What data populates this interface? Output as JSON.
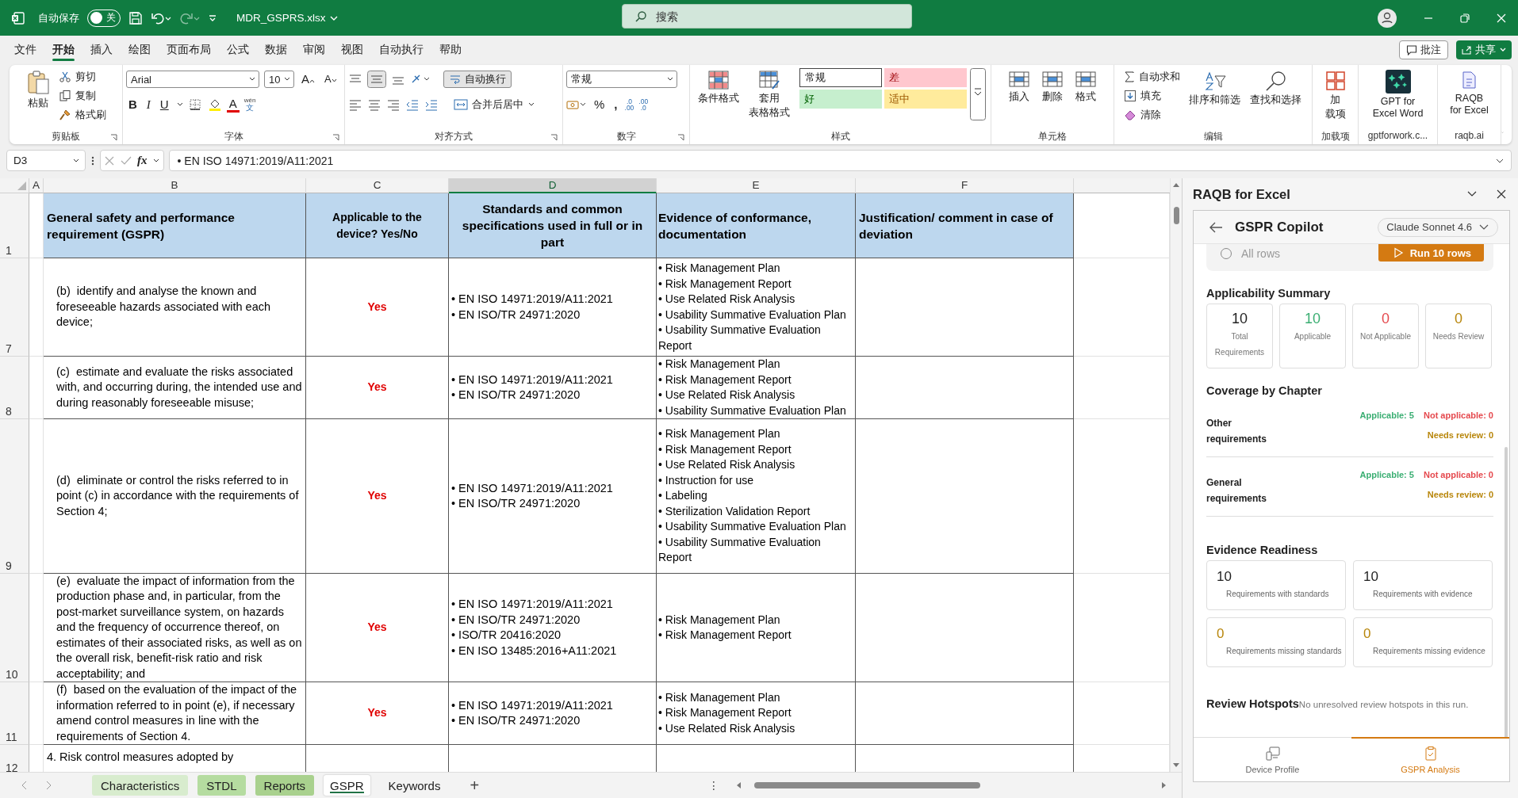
{
  "title_bar": {
    "autosave_label": "自动保存",
    "autosave_toggle": {
      "label": "关",
      "on": false
    },
    "filename": "MDR_GSPRS.xlsx",
    "search_placeholder": "搜索"
  },
  "menu_tabs": [
    {
      "label": "文件",
      "selected": false
    },
    {
      "label": "开始",
      "selected": true
    },
    {
      "label": "插入",
      "selected": false
    },
    {
      "label": "绘图",
      "selected": false
    },
    {
      "label": "页面布局",
      "selected": false
    },
    {
      "label": "公式",
      "selected": false
    },
    {
      "label": "数据",
      "selected": false
    },
    {
      "label": "审阅",
      "selected": false
    },
    {
      "label": "视图",
      "selected": false
    },
    {
      "label": "自动执行",
      "selected": false
    },
    {
      "label": "帮助",
      "selected": false
    }
  ],
  "comment_button": "批注",
  "share_button": "共享",
  "ribbon": {
    "clipboard": {
      "paste": "粘贴",
      "cut": "剪切",
      "copy": "复制",
      "format_painter": "格式刷",
      "label": "剪贴板"
    },
    "font": {
      "font_name": "Arial",
      "font_size": "10",
      "grow": "A",
      "shrink": "A",
      "bold": "B",
      "italic": "I",
      "underline": "U",
      "font_color": "A",
      "phonetic_top": "wén",
      "phonetic_bottom": "文",
      "label": "字体"
    },
    "alignment": {
      "wrap_text": {
        "label": "自动换行",
        "on": true
      },
      "merge": "合并后居中",
      "label": "对齐方式"
    },
    "number": {
      "format": "常规",
      "percent": "%",
      "comma": ",",
      "decimals": [
        {
          "top": ".0",
          "bottom": ".00"
        },
        {
          "top": ".00",
          "bottom": ".0"
        }
      ],
      "label": "数字"
    },
    "styles": {
      "conditional": "条件格式",
      "table_format": [
        "套用",
        "表格格式"
      ],
      "cell_styles": [
        {
          "label": "常规",
          "kind": "normal"
        },
        {
          "label": "差",
          "kind": "bad"
        },
        {
          "label": "好",
          "kind": "good"
        },
        {
          "label": "适中",
          "kind": "neutral"
        }
      ],
      "label": "样式"
    },
    "cells": {
      "buttons": [
        "插入",
        "删除",
        "格式"
      ],
      "label": "单元格"
    },
    "editing": {
      "autosum": "自动求和",
      "fill": "填充",
      "clear": "清除",
      "sort_filter": "排序和筛选",
      "find_select": "查找和选择",
      "label": "编辑"
    },
    "addins": {
      "button": [
        "加",
        "载项"
      ],
      "label": "加载项"
    },
    "gpt": {
      "button": "GPT for\nExcel Word",
      "label": "gptforwork.c..."
    },
    "raqb": {
      "button": "RAQB\nfor Excel",
      "label": "raqb.ai"
    }
  },
  "formula_bar": {
    "name_box": "D3",
    "fx": "fx",
    "value": "• EN ISO 14971:2019/A11:2021"
  },
  "sheet": {
    "columns": [
      {
        "label": "A",
        "selected": false
      },
      {
        "label": "B",
        "selected": false
      },
      {
        "label": "C",
        "selected": false
      },
      {
        "label": "D",
        "selected": true
      },
      {
        "label": "E",
        "selected": false
      },
      {
        "label": "F",
        "selected": false
      }
    ],
    "rows": [
      {
        "number": "1",
        "kind": "header",
        "b": "General safety and performance requirement (GSPR)",
        "c": "Applicable to the device? Yes/No",
        "d": [
          "Standards and common specifications used in full or in part"
        ],
        "e": [
          "Evidence of conformance, documentation"
        ],
        "f": "Justification/ comment in case of deviation"
      },
      {
        "number": "7",
        "kind": "item",
        "b": "(b)  identify and analyse the known and foreseeable hazards associated with each device;",
        "c": "Yes",
        "d": [
          "• EN ISO 14971:2019/A11:2021",
          "• EN ISO/TR 24971:2020"
        ],
        "e": [
          "• Risk Management Plan",
          "• Risk Management Report",
          "• Use Related Risk Analysis",
          "• Usability Summative Evaluation Plan",
          "• Usability Summative Evaluation Report"
        ]
      },
      {
        "number": "8",
        "kind": "item",
        "b": "(c)  estimate and evaluate the risks associated with, and occurring during, the intended use and during reasonably foreseeable misuse;",
        "c": "Yes",
        "d": [
          "• EN ISO 14971:2019/A11:2021",
          "• EN ISO/TR 24971:2020"
        ],
        "e": [
          "• Risk Management Plan",
          "• Risk Management Report",
          "• Use Related Risk Analysis",
          "• Usability Summative Evaluation Plan"
        ]
      },
      {
        "number": "9",
        "kind": "item",
        "b": "(d)  eliminate or control the risks referred to in point (c) in accordance with the requirements of Section 4;",
        "c": "Yes",
        "d": [
          "• EN ISO 14971:2019/A11:2021",
          "• EN ISO/TR 24971:2020"
        ],
        "e": [
          "• Risk Management Plan",
          "• Risk Management Report",
          "• Use Related Risk Analysis",
          "• Instruction for use",
          "• Labeling",
          "• Sterilization Validation Report",
          "• Usability Summative Evaluation Plan",
          "• Usability Summative Evaluation Report"
        ]
      },
      {
        "number": "10",
        "kind": "item",
        "b": "(e)  evaluate the impact of information from the production phase and, in particular, from the post-market surveillance system, on hazards and the frequency of occurrence thereof, on estimates of their associated risks, as well as on the overall risk, benefit-risk ratio and risk acceptability; and",
        "c": "Yes",
        "d": [
          "• EN ISO 14971:2019/A11:2021",
          "• EN ISO/TR 24971:2020",
          "• ISO/TR 20416:2020",
          "• EN ISO 13485:2016+A11:2021"
        ],
        "e": [
          "• Risk Management Plan",
          "• Risk Management Report"
        ]
      },
      {
        "number": "11",
        "kind": "item",
        "b": "(f)  based on the evaluation of the impact of the information referred to in point (e), if necessary amend control measures in line with the requirements of Section 4.",
        "c": "Yes",
        "d": [
          "• EN ISO 14971:2019/A11:2021",
          "• EN ISO/TR 24971:2020"
        ],
        "e": [
          "• Risk Management Plan",
          "• Risk Management Report",
          "• Use Related Risk Analysis"
        ]
      },
      {
        "number": "12",
        "kind": "section",
        "b": "4. Risk control measures adopted by"
      }
    ]
  },
  "sheet_tabs": [
    {
      "label": "Characteristics",
      "selected": false,
      "color": "#d8ecce"
    },
    {
      "label": "STDL",
      "selected": false,
      "color": "#b5dca0"
    },
    {
      "label": "Reports",
      "selected": false,
      "color": "#a9d18e"
    },
    {
      "label": "GSPR",
      "selected": true
    },
    {
      "label": "Keywords",
      "selected": false
    }
  ],
  "add_sheet": "+",
  "tab_menu": "⋮",
  "panel": {
    "title": "RAQB for Excel",
    "header": "GSPR Copilot",
    "model": "Claude Sonnet 4.6",
    "scope_radio": {
      "label": "All rows",
      "selected": false
    },
    "run_button": "Run 10 rows",
    "applicability": {
      "title": "Applicability Summary",
      "stats": [
        {
          "value": "10",
          "label": "Total Requirements",
          "color": "#1f1f1f"
        },
        {
          "value": "10",
          "label": "Applicable",
          "color": "#3aae72"
        },
        {
          "value": "0",
          "label": "Not Applicable",
          "color": "#e5484d"
        },
        {
          "value": "0",
          "label": "Needs Review",
          "color": "#b8860b"
        }
      ]
    },
    "coverage": {
      "title": "Coverage by Chapter",
      "chapters": [
        {
          "name": "Other requirements",
          "applicable": "Applicable: 5",
          "not_applicable": "Not applicable: 0",
          "needs_review": "Needs review: 0"
        },
        {
          "name": "General requirements",
          "applicable": "Applicable: 5",
          "not_applicable": "Not applicable: 0",
          "needs_review": "Needs review: 0"
        }
      ]
    },
    "evidence": {
      "title": "Evidence Readiness",
      "stats": [
        {
          "value": "10",
          "label": "Requirements with standards",
          "color": "#1f1f1f"
        },
        {
          "value": "10",
          "label": "Requirements with evidence",
          "color": "#1f1f1f"
        },
        {
          "value": "0",
          "label": "Requirements missing standards",
          "color": "#b8860b"
        },
        {
          "value": "0",
          "label": "Requirements missing evidence",
          "color": "#b8860b"
        }
      ]
    },
    "hotspots": {
      "title": "Review Hotspots",
      "message": "No unresolved review hotspots in this run."
    },
    "nav": [
      {
        "label": "Device Profile",
        "selected": false
      },
      {
        "label": "GSPR Analysis",
        "selected": true
      }
    ]
  }
}
